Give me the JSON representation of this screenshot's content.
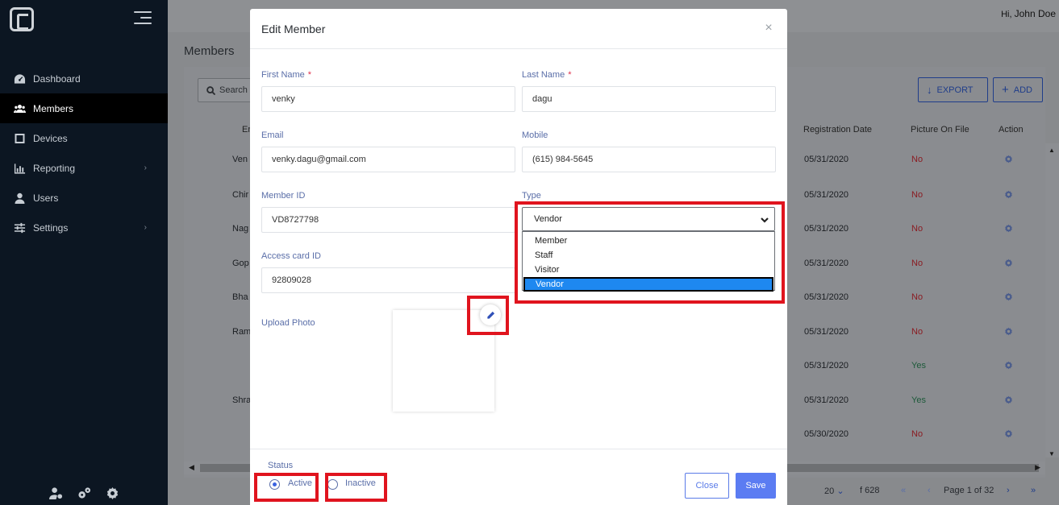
{
  "header": {
    "greeting_prefix": "Hi,",
    "user_name": "John Doe"
  },
  "sidebar": {
    "items": [
      {
        "label": "Dashboard",
        "icon": "dashboard-icon"
      },
      {
        "label": "Members",
        "icon": "members-icon"
      },
      {
        "label": "Devices",
        "icon": "devices-icon"
      },
      {
        "label": "Reporting",
        "icon": "reporting-icon"
      },
      {
        "label": "Users",
        "icon": "users-icon"
      },
      {
        "label": "Settings",
        "icon": "settings-icon"
      }
    ],
    "active": "Members"
  },
  "page": {
    "title": "Members",
    "search_placeholder": "Search",
    "export_label": "EXPORT",
    "add_label": "ADD",
    "columns": [
      "Er",
      "Registration Date",
      "Picture On File",
      "Action"
    ],
    "rows": [
      {
        "name": "Ven",
        "date": "05/31/2020",
        "picture": "No"
      },
      {
        "name": "Chir",
        "date": "05/31/2020",
        "picture": "No"
      },
      {
        "name": "Nag",
        "date": "05/31/2020",
        "picture": "No"
      },
      {
        "name": "Gop",
        "date": "05/31/2020",
        "picture": "No"
      },
      {
        "name": "Bha",
        "date": "05/31/2020",
        "picture": "No"
      },
      {
        "name": "Ram",
        "date": "05/31/2020",
        "picture": "No"
      },
      {
        "name": "",
        "date": "05/31/2020",
        "picture": "Yes"
      },
      {
        "name": "Shra",
        "date": "05/31/2020",
        "picture": "Yes"
      },
      {
        "name": "",
        "date": "05/30/2020",
        "picture": "No"
      }
    ],
    "pagination": {
      "page_size": "20",
      "of_total": "f 628",
      "page_label": "Page 1 of 32"
    }
  },
  "modal": {
    "title": "Edit Member",
    "first_name": {
      "label": "First Name",
      "required": "*",
      "value": "venky"
    },
    "last_name": {
      "label": "Last Name",
      "required": "*",
      "value": "dagu"
    },
    "email": {
      "label": "Email",
      "value": "venky.dagu@gmail.com"
    },
    "mobile": {
      "label": "Mobile",
      "value": "(615) 984-5645"
    },
    "member_id": {
      "label": "Member ID",
      "value": "VD8727798"
    },
    "type": {
      "label": "Type",
      "value": "Vendor",
      "options": [
        "Member",
        "Staff",
        "Visitor",
        "Vendor"
      ],
      "selected_index": 3
    },
    "access_card": {
      "label": "Access card ID",
      "value": "92809028"
    },
    "upload_photo_label": "Upload Photo",
    "status": {
      "label": "Status",
      "active_label": "Active",
      "inactive_label": "Inactive",
      "selected": "Active"
    },
    "close_label": "Close",
    "save_label": "Save"
  },
  "colors": {
    "highlight": "#e0141e",
    "accent": "#5b7cf2",
    "sidebar_bg": "#0c1622"
  }
}
